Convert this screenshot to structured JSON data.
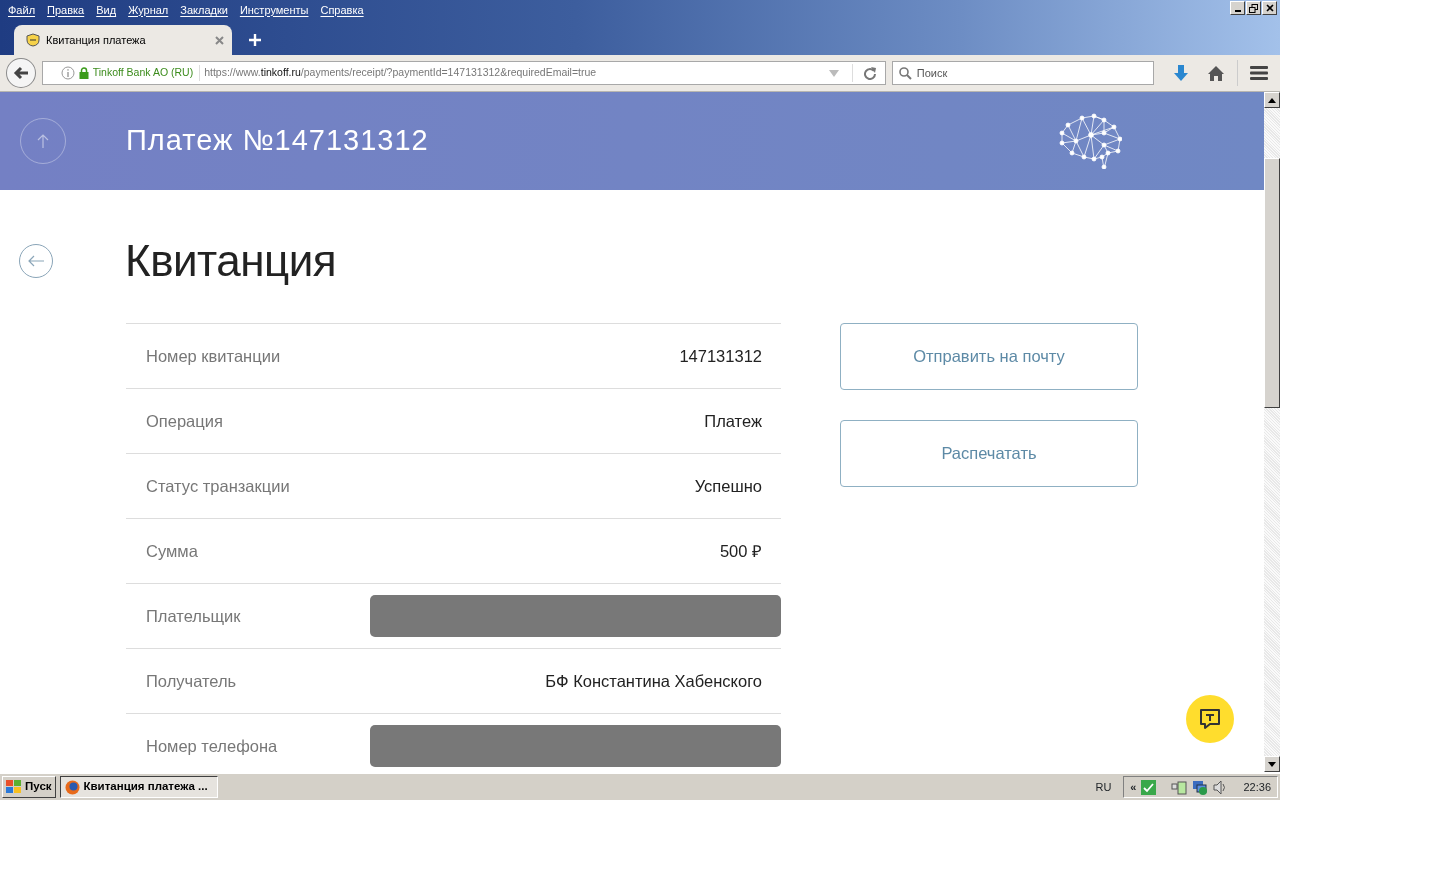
{
  "menu": [
    "Файл",
    "Правка",
    "Вид",
    "Журнал",
    "Закладки",
    "Инструменты",
    "Справка"
  ],
  "tabs": [
    {
      "title": "Квитанция платежа",
      "selected": true
    }
  ],
  "address_bar": {
    "identity": "Tinkoff Bank AO (RU)",
    "url": "https://www.**tinkoff.ru**/payments/receipt/?paymentId=147131312&requiredEmail=true"
  },
  "search": {
    "placeholder": "Поиск"
  },
  "header": {
    "title": "Платеж №147131312"
  },
  "page_title": "Квитанция",
  "receipt_rows": [
    {
      "label": "Номер квитанции",
      "value": "147131312",
      "redacted": false
    },
    {
      "label": "Операция",
      "value": "Платеж",
      "redacted": false
    },
    {
      "label": "Статус транзакции",
      "value": "Успешно",
      "redacted": false
    },
    {
      "label": "Сумма",
      "value": "500 ₽",
      "redacted": false
    },
    {
      "label": "Плательщик",
      "redacted": true
    },
    {
      "label": "Получатель",
      "value": "БФ Константина Хабенского",
      "redacted": false
    },
    {
      "label": "Номер телефона",
      "redacted": true
    }
  ],
  "actions": [
    "Отправить на почту",
    "Распечатать"
  ],
  "taskbar": {
    "start": "Пуск",
    "tray_chevron": "«",
    "windows": [
      {
        "title": "Квитанция платежа ...",
        "selected": true
      }
    ],
    "language": "RU",
    "clock": "22:36"
  }
}
